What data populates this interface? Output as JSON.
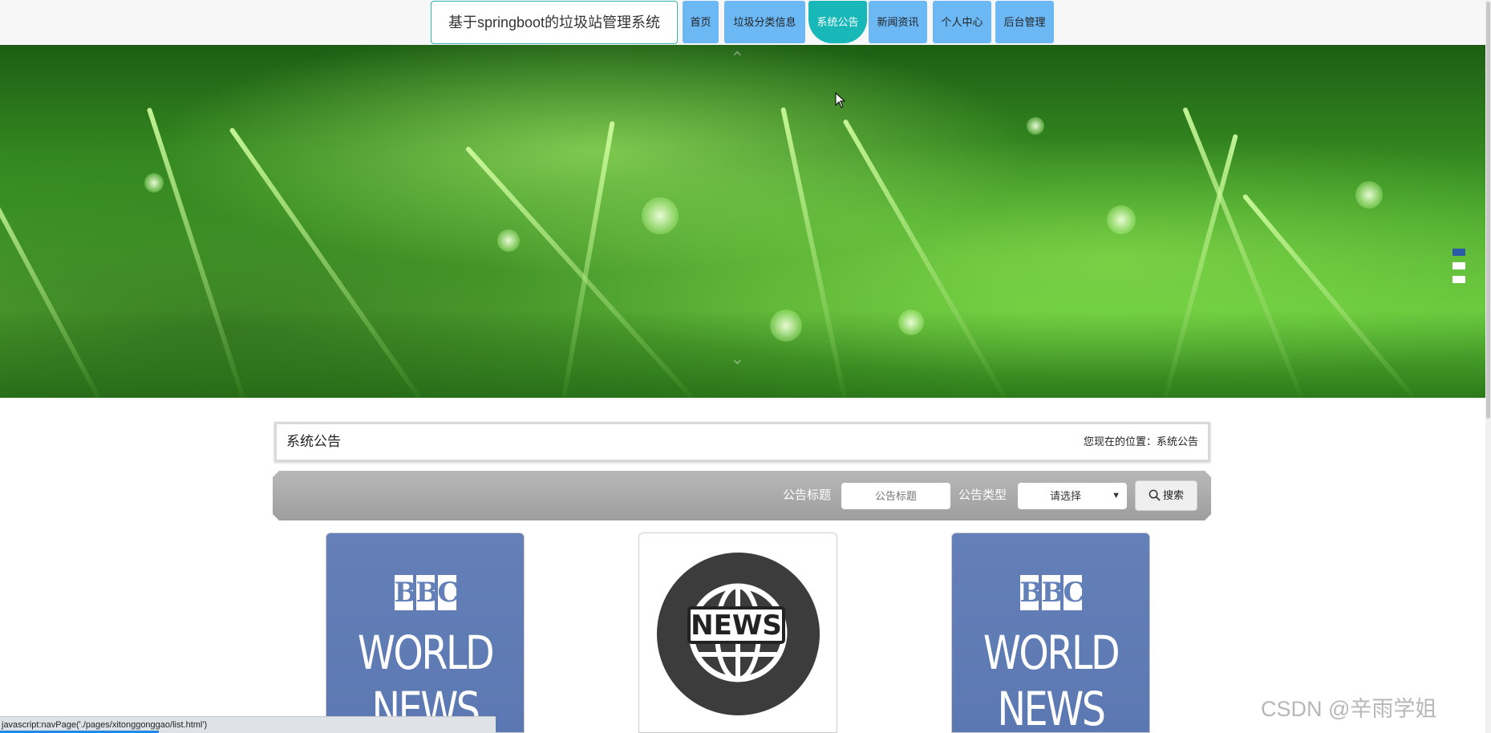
{
  "header": {
    "site_title": "基于springboot的垃圾站管理系统",
    "nav": [
      {
        "label": "首页"
      },
      {
        "label": "垃圾分类信息"
      },
      {
        "label": "系统公告",
        "active": true
      },
      {
        "label": "新闻资讯"
      },
      {
        "label": "个人中心"
      },
      {
        "label": "后台管理"
      }
    ],
    "active_color": "#19b8b8",
    "nav_color": "#6bb8f5"
  },
  "banner": {
    "slides": 3,
    "active_slide": 1
  },
  "breadcrumb": {
    "title": "系统公告",
    "location": "您现在的位置：系统公告"
  },
  "search": {
    "title_label": "公告标题",
    "title_placeholder": "公告标题",
    "type_label": "公告类型",
    "type_value": "请选择",
    "button_label": "搜索",
    "button_icon": "search-icon"
  },
  "cards": [
    {
      "image": "bbc-world-news",
      "letters": [
        "B",
        "B",
        "C"
      ],
      "line1": "WORLD",
      "line2": "NEWS"
    },
    {
      "image": "news-globe",
      "label": "NEWS"
    },
    {
      "image": "bbc-world-news",
      "letters": [
        "B",
        "B",
        "C"
      ],
      "line1": "WORLD",
      "line2": "NEWS"
    }
  ],
  "status_bar": {
    "url": "javascript:navPage('./pages/xitonggonggao/list.html')"
  },
  "watermark": "CSDN @辛雨学姐"
}
